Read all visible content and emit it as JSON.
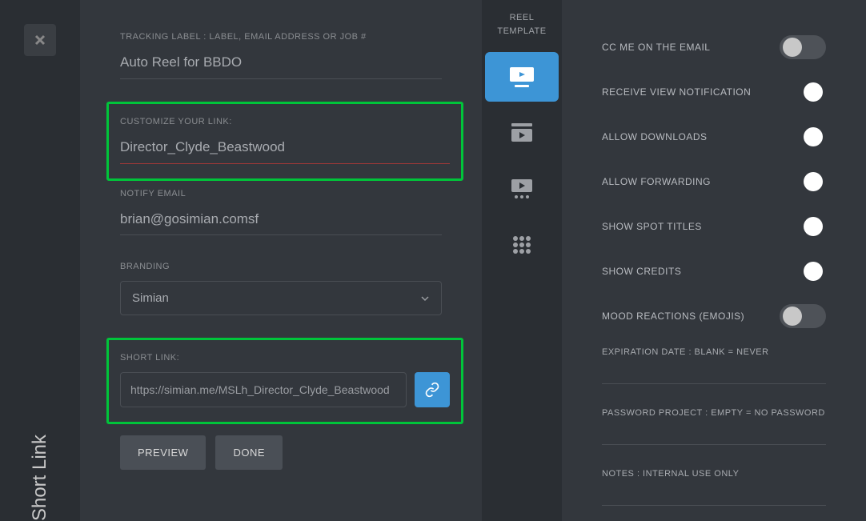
{
  "side_label": "Short Link",
  "form": {
    "tracking_label": "TRACKING LABEL : LABEL, EMAIL ADDRESS OR JOB #",
    "tracking_value": "Auto Reel for BBDO",
    "customize_label": "CUSTOMIZE YOUR LINK:",
    "customize_value": "Director_Clyde_Beastwood",
    "notify_label": "NOTIFY EMAIL",
    "notify_value": "brian@gosimian.comsf",
    "branding_label": "BRANDING",
    "branding_value": "Simian",
    "shortlink_label": "SHORT LINK:",
    "shortlink_value": "https://simian.me/MSLh_Director_Clyde_Beastwood",
    "preview_btn": "PREVIEW",
    "done_btn": "DONE"
  },
  "template_col": {
    "title_line1": "REEL",
    "title_line2": "TEMPLATE"
  },
  "settings": {
    "toggles": [
      {
        "label": "CC ME ON THE EMAIL",
        "on": false
      },
      {
        "label": "RECEIVE VIEW NOTIFICATION",
        "on": true
      },
      {
        "label": "ALLOW DOWNLOADS",
        "on": true
      },
      {
        "label": "ALLOW FORWARDING",
        "on": true
      },
      {
        "label": "SHOW SPOT TITLES",
        "on": true
      },
      {
        "label": "SHOW CREDITS",
        "on": true
      },
      {
        "label": "MOOD REACTIONS (EMOJIS)",
        "on": false
      }
    ],
    "expiration_label": "EXPIRATION DATE : BLANK = NEVER",
    "password_label": "PASSWORD PROJECT : EMPTY = NO PASSWORD",
    "notes_label": "NOTES : INTERNAL USE ONLY"
  }
}
